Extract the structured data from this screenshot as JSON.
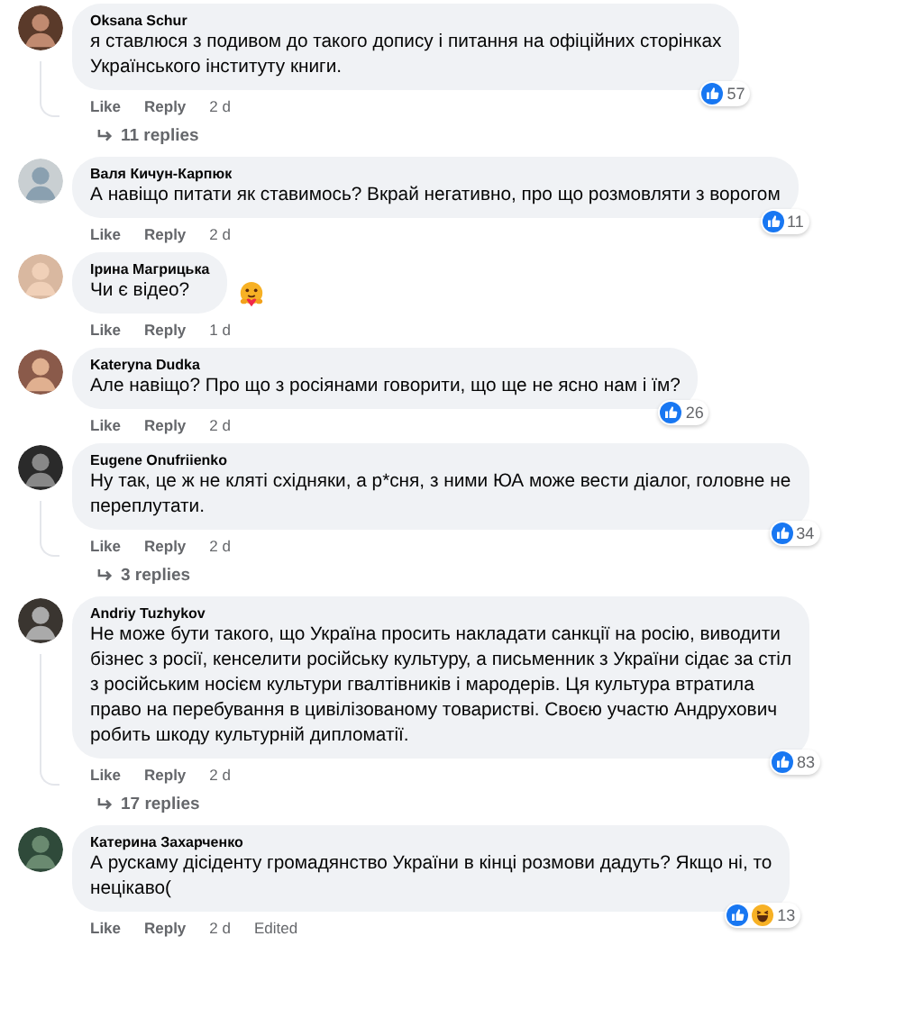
{
  "comments": [
    {
      "author": "Oksana Schur",
      "lines": [
        "я ставлюся з подивом до такого допису і питання на офіційних сторінках",
        "Українського інституту книги."
      ],
      "reactions": [
        {
          "kind": "like"
        }
      ],
      "reaction_count": "57",
      "like": "Like",
      "reply": "Reply",
      "time": "2 d",
      "replies": "11 replies"
    },
    {
      "author": "Валя Кичун-Карпюк",
      "lines": [
        "А навіщо питати як ставимось? Вкрай негативно, про що розмовляти з ворогом"
      ],
      "reactions": [
        {
          "kind": "like"
        }
      ],
      "reaction_count": "11",
      "like": "Like",
      "reply": "Reply",
      "time": "2 d"
    },
    {
      "author": "Ірина Магрицька",
      "lines": [
        "Чи є відео?"
      ],
      "reactions": [
        {
          "kind": "care"
        }
      ],
      "like": "Like",
      "reply": "Reply",
      "time": "1 d"
    },
    {
      "author": "Kateryna Dudka",
      "lines": [
        "Але навіщо? Про що з росіянами говорити, що ще не ясно нам і їм?"
      ],
      "reactions": [
        {
          "kind": "like"
        }
      ],
      "reaction_count": "26",
      "like": "Like",
      "reply": "Reply",
      "time": "2 d"
    },
    {
      "author": "Eugene Onufriienko",
      "lines": [
        "Ну так, це ж не кляті східняки, а р*сня, з ними ЮА може вести діалог, головне не",
        "переплутати."
      ],
      "reactions": [
        {
          "kind": "like"
        }
      ],
      "reaction_count": "34",
      "like": "Like",
      "reply": "Reply",
      "time": "2 d",
      "replies": "3 replies"
    },
    {
      "author": "Andriy Tuzhykov",
      "lines": [
        "Не може бути такого, що Україна просить накладати санкції на росію, виводити",
        "бізнес з росії, кенселити російську культуру, а письменник з України сідає за стіл",
        "з російським носієм культури гвалтівників і мародерів. Ця культура втратила",
        "право на перебування в цивілізованому товаристві. Своєю участю Андрухович",
        "робить шкоду культурній дипломатії."
      ],
      "reactions": [
        {
          "kind": "like"
        }
      ],
      "reaction_count": "83",
      "like": "Like",
      "reply": "Reply",
      "time": "2 d",
      "replies": "17 replies"
    },
    {
      "author": "Катерина Захарченко",
      "lines": [
        "А рускаму дісіденту громадянство України в кінці розмови дадуть? Якщо ні, то",
        "нецікаво("
      ],
      "reactions": [
        {
          "kind": "like"
        },
        {
          "kind": "haha"
        }
      ],
      "reaction_count": "13",
      "like": "Like",
      "reply": "Reply",
      "time": "2 d",
      "edited": "Edited"
    }
  ]
}
